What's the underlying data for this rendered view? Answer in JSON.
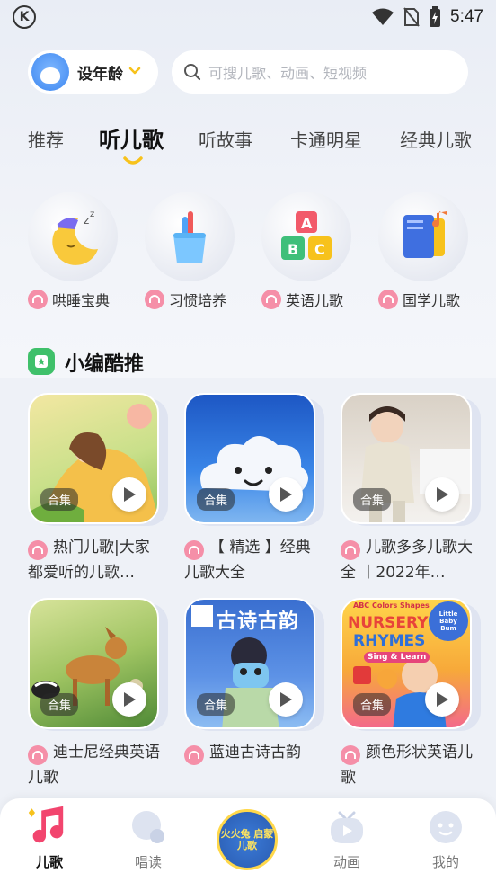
{
  "status_bar": {
    "time": "5:47"
  },
  "header": {
    "age_label": "设年龄",
    "search_placeholder": "可搜儿歌、动画、短视频"
  },
  "tabs": [
    "推荐",
    "听儿歌",
    "听故事",
    "卡通明星",
    "经典儿歌"
  ],
  "active_tab": "听儿歌",
  "categories": [
    {
      "label": "哄睡宝典",
      "icon": "moon-sleep-icon"
    },
    {
      "label": "习惯培养",
      "icon": "toothbrush-cup-icon"
    },
    {
      "label": "英语儿歌",
      "icon": "abc-blocks-icon"
    },
    {
      "label": "国学儿歌",
      "icon": "book-music-icon"
    }
  ],
  "section": {
    "title": "小编酷推"
  },
  "badge_label": "合集",
  "cards": [
    {
      "title": "热门儿歌|大家都爱听的儿歌…"
    },
    {
      "title": "【 精选 】经典儿歌大全"
    },
    {
      "title": "儿歌多多儿歌大全 丨2022年…"
    },
    {
      "title": "迪士尼经典英语儿歌"
    },
    {
      "title": "蓝迪古诗古韵"
    },
    {
      "title": "颜色形状英语儿歌"
    }
  ],
  "card_images": {
    "poetry_text": "古诗古韵",
    "nursery_line1": "NURSERY",
    "nursery_line2": "RHYMES",
    "nursery_top": "ABC Colors Shapes",
    "nursery_brand": "Little Baby Bum",
    "nursery_sub": "Sing & Learn"
  },
  "bottom_nav": [
    {
      "label": "儿歌",
      "icon": "music-note-icon"
    },
    {
      "label": "唱读",
      "icon": "sing-read-icon"
    },
    {
      "label": "",
      "icon": "center-logo-icon"
    },
    {
      "label": "动画",
      "icon": "tv-play-icon"
    },
    {
      "label": "我的",
      "icon": "profile-face-icon"
    }
  ],
  "center_logo_text": "火火兔 启蒙儿歌",
  "colors": {
    "accent": "#f7c21c",
    "pink": "#f58fa8",
    "green": "#3fc06a"
  }
}
